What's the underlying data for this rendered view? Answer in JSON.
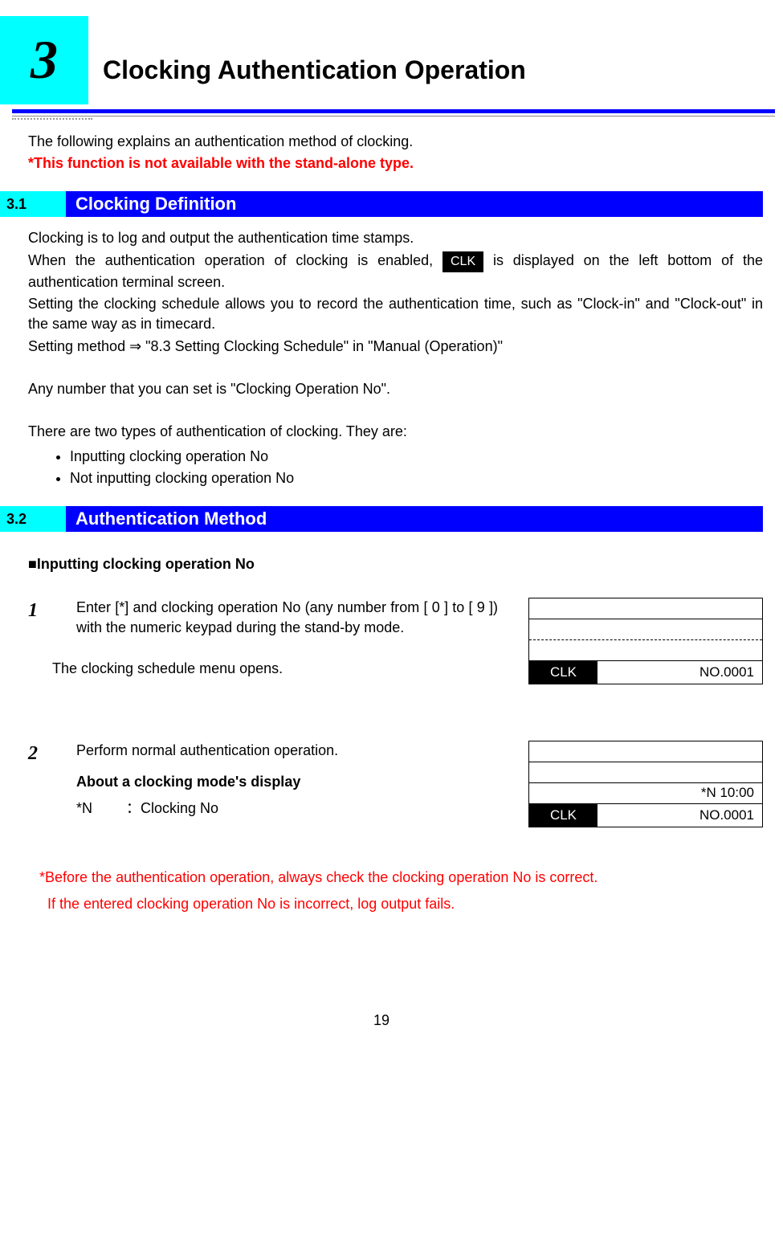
{
  "chapter": {
    "number": "3",
    "title": "Clocking Authentication Operation"
  },
  "intro": {
    "line1": "The following explains an authentication method of clocking.",
    "line2": "*This function is not available with the stand-alone type."
  },
  "section1": {
    "num": "3.1",
    "title": "Clocking Definition",
    "p1": "Clocking is to log and output the authentication time stamps.",
    "p2a": "When the authentication operation of clocking is enabled, ",
    "clk_chip": "CLK",
    "p2b": " is displayed on the left bottom of the authentication terminal screen.",
    "p3": "Setting the clocking schedule allows you to record the authentication time, such as \"Clock-in\" and \"Clock-out\" in the same way as in timecard.",
    "p4": "Setting method ⇒ \"8.3 Setting Clocking Schedule\" in \"Manual (Operation)\"",
    "p5": "Any number that you can set is \"Clocking Operation No\".",
    "p6": "There are two types of authentication of clocking. They are:",
    "bullets": [
      "Inputting clocking operation No",
      "Not inputting clocking operation No"
    ]
  },
  "section2": {
    "num": "3.2",
    "title": "Authentication Method",
    "subheading": "■Inputting clocking operation No",
    "step1": {
      "num": "1",
      "text": "Enter [*] and clocking operation No (any number from [ 0 ] to [ 9 ]) with the numeric keypad during the stand-by mode.",
      "text2": "The clocking schedule menu opens.",
      "display": {
        "clk": "CLK",
        "no": "NO.0001"
      }
    },
    "step2": {
      "num": "2",
      "text": "Perform normal authentication operation.",
      "about_heading": "About a clocking mode's display",
      "about_n": "*N",
      "about_desc": "：Clocking No",
      "display": {
        "row3_right": "*N 10:00",
        "clk": "CLK",
        "no": "NO.0001"
      }
    },
    "warning1": "*Before the authentication operation, always check the clocking operation No is correct.",
    "warning2": "If the entered clocking operation No is incorrect, log output fails."
  },
  "page_number": "19"
}
